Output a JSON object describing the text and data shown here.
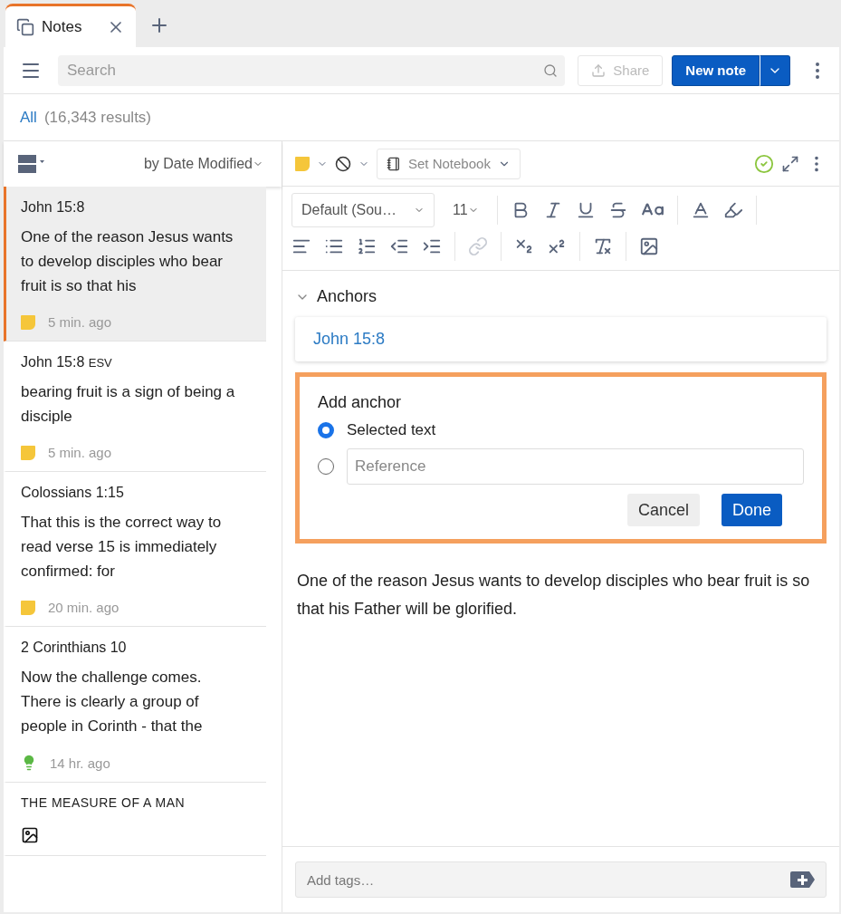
{
  "tabs": [
    {
      "label": "Notes",
      "selected": true
    }
  ],
  "search": {
    "placeholder": "Search"
  },
  "actions": {
    "share": "Share",
    "new_note": "New note",
    "share_disabled": true
  },
  "filter": {
    "label": "All",
    "count": "(16,343 results)"
  },
  "sort": {
    "label": "by Date Modified"
  },
  "notes": [
    {
      "kind": "note",
      "title": "John 15:8",
      "body": "One of the reason Jesus wants to develop disciples who bear fruit is so that his",
      "time": "5 min. ago",
      "selected": true
    },
    {
      "kind": "note",
      "title": "John 15:8",
      "version": "ESV",
      "body": "bearing fruit is a sign of being a disciple",
      "time": "5 min. ago",
      "selected": false
    },
    {
      "kind": "note",
      "title": "Colossians 1:15",
      "body": "That this is the correct way to read verse 15 is immediately confirmed: for",
      "time": "20 min. ago",
      "selected": false
    },
    {
      "kind": "highlight",
      "title": "2 Corinthians 10",
      "body": "Now the challenge comes. There is clearly a group of people in Corinth - that the",
      "time": "14 hr. ago",
      "selected": false
    },
    {
      "kind": "image",
      "title": "THE MEASURE OF A MAN",
      "selected": false
    }
  ],
  "editor": {
    "notebook": "Set Notebook",
    "font": "Default (Sou…",
    "size": "11",
    "tools": [
      {
        "kind": "align",
        "disabled": false
      },
      {
        "kind": "bullets",
        "disabled": false
      },
      {
        "kind": "numbers",
        "disabled": false
      },
      {
        "kind": "outdent",
        "disabled": false
      },
      {
        "kind": "indent",
        "disabled": false
      },
      {
        "kind": "link",
        "disabled": true
      },
      {
        "kind": "sub",
        "disabled": false
      },
      {
        "kind": "sup",
        "disabled": false
      },
      {
        "kind": "clear",
        "disabled": false
      },
      {
        "kind": "image",
        "disabled": false
      }
    ]
  },
  "anchors": {
    "title": "Anchors",
    "expanded": true,
    "items": [
      "John 15:8"
    ]
  },
  "anchor_form": {
    "title": "Add anchor",
    "options": [
      {
        "kind": "text",
        "label": "Selected text",
        "selected": true
      },
      {
        "kind": "reference",
        "placeholder": "Reference",
        "selected": false
      }
    ],
    "cancel": "Cancel",
    "done": "Done"
  },
  "content": "One of the reason Jesus wants to develop disciples who bear fruit is so that his Father will be glorified.",
  "tags": {
    "placeholder": "Add tags…"
  }
}
